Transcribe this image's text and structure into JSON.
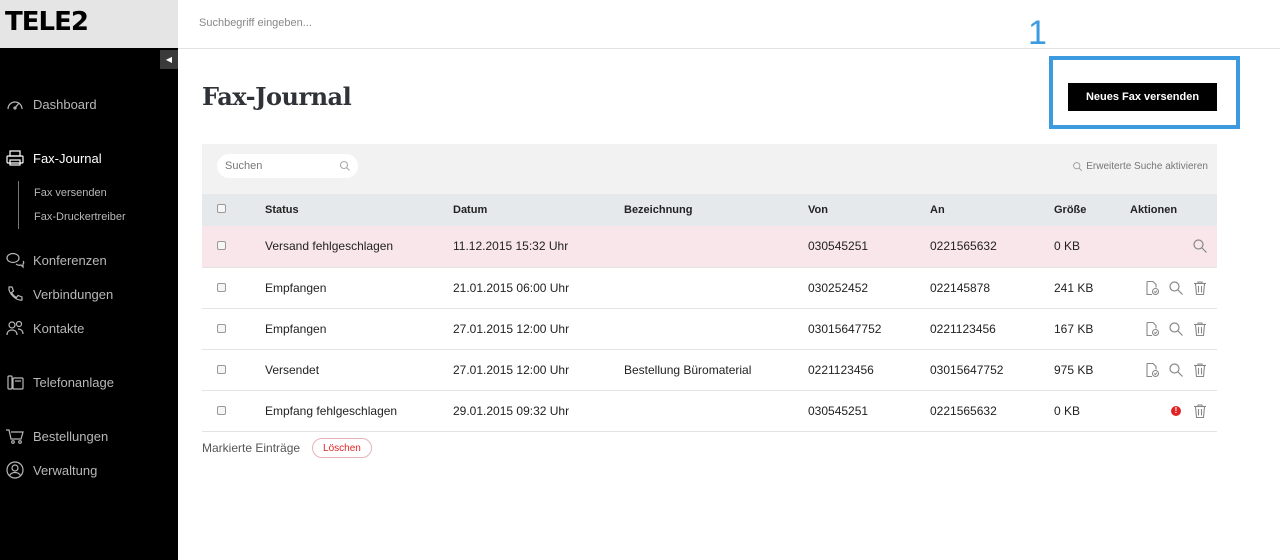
{
  "brand": {
    "logo_text": "TELE2"
  },
  "topbar": {
    "search_placeholder": "Suchbegriff eingeben..."
  },
  "sidebar": {
    "collapse_glyph": "◀",
    "items": [
      {
        "label": "Dashboard",
        "icon": "gauge-icon",
        "active": false
      },
      {
        "label": "Fax-Journal",
        "icon": "printer-icon",
        "active": true
      },
      {
        "label": "Konferenzen",
        "icon": "chat-bubbles-icon",
        "active": false
      },
      {
        "label": "Verbindungen",
        "icon": "phone-icon",
        "active": false
      },
      {
        "label": "Kontakte",
        "icon": "contacts-icon",
        "active": false
      },
      {
        "label": "Telefonanlage",
        "icon": "desk-phone-icon",
        "active": false
      },
      {
        "label": "Bestellungen",
        "icon": "cart-icon",
        "active": false
      },
      {
        "label": "Verwaltung",
        "icon": "user-circle-icon",
        "active": false
      }
    ],
    "subitems": [
      {
        "label": "Fax versenden"
      },
      {
        "label": "Fax-Druckertreiber"
      }
    ]
  },
  "main": {
    "title": "Fax-Journal",
    "annotation_number": "1",
    "new_fax_button": "Neues Fax versenden",
    "filter": {
      "search_placeholder": "Suchen",
      "advanced_search": "Erweiterte Suche aktivieren"
    },
    "table": {
      "columns": [
        "Status",
        "Datum",
        "Bezeichnung",
        "Von",
        "An",
        "Größe",
        "Aktionen"
      ],
      "rows": [
        {
          "status": "Versand fehlgeschlagen",
          "date": "11.12.2015 15:32 Uhr",
          "label": "",
          "from": "030545251",
          "to": "0221565632",
          "size": "0 KB",
          "actions": [
            "search-icon"
          ],
          "highlight": true
        },
        {
          "status": "Empfangen",
          "date": "21.01.2015 06:00 Uhr",
          "label": "",
          "from": "030252452",
          "to": "022145878",
          "size": "241 KB",
          "actions": [
            "file-refresh-icon",
            "search-icon",
            "trash-icon"
          ],
          "highlight": false
        },
        {
          "status": "Empfangen",
          "date": "27.01.2015 12:00 Uhr",
          "label": "",
          "from": "03015647752",
          "to": "0221123456",
          "size": "167 KB",
          "actions": [
            "file-refresh-icon",
            "search-icon",
            "trash-icon"
          ],
          "highlight": false
        },
        {
          "status": "Versendet",
          "date": "27.01.2015 12:00 Uhr",
          "label": "Bestellung Büromaterial",
          "from": "0221123456",
          "to": "03015647752",
          "size": "975 KB",
          "actions": [
            "file-refresh-icon",
            "search-icon",
            "trash-icon"
          ],
          "highlight": false
        },
        {
          "status": "Empfang fehlgeschlagen",
          "date": "29.01.2015 09:32 Uhr",
          "label": "",
          "from": "030545251",
          "to": "0221565632",
          "size": "0 KB",
          "actions": [
            "error-icon",
            "trash-icon"
          ],
          "highlight": false
        }
      ]
    },
    "bulk": {
      "label": "Markierte Einträge",
      "delete_button": "Löschen"
    }
  },
  "colors": {
    "sidebar_bg": "#000000",
    "annotation": "#3c9be0",
    "error_row_bg": "#f8e6ea",
    "danger": "#e02424"
  }
}
